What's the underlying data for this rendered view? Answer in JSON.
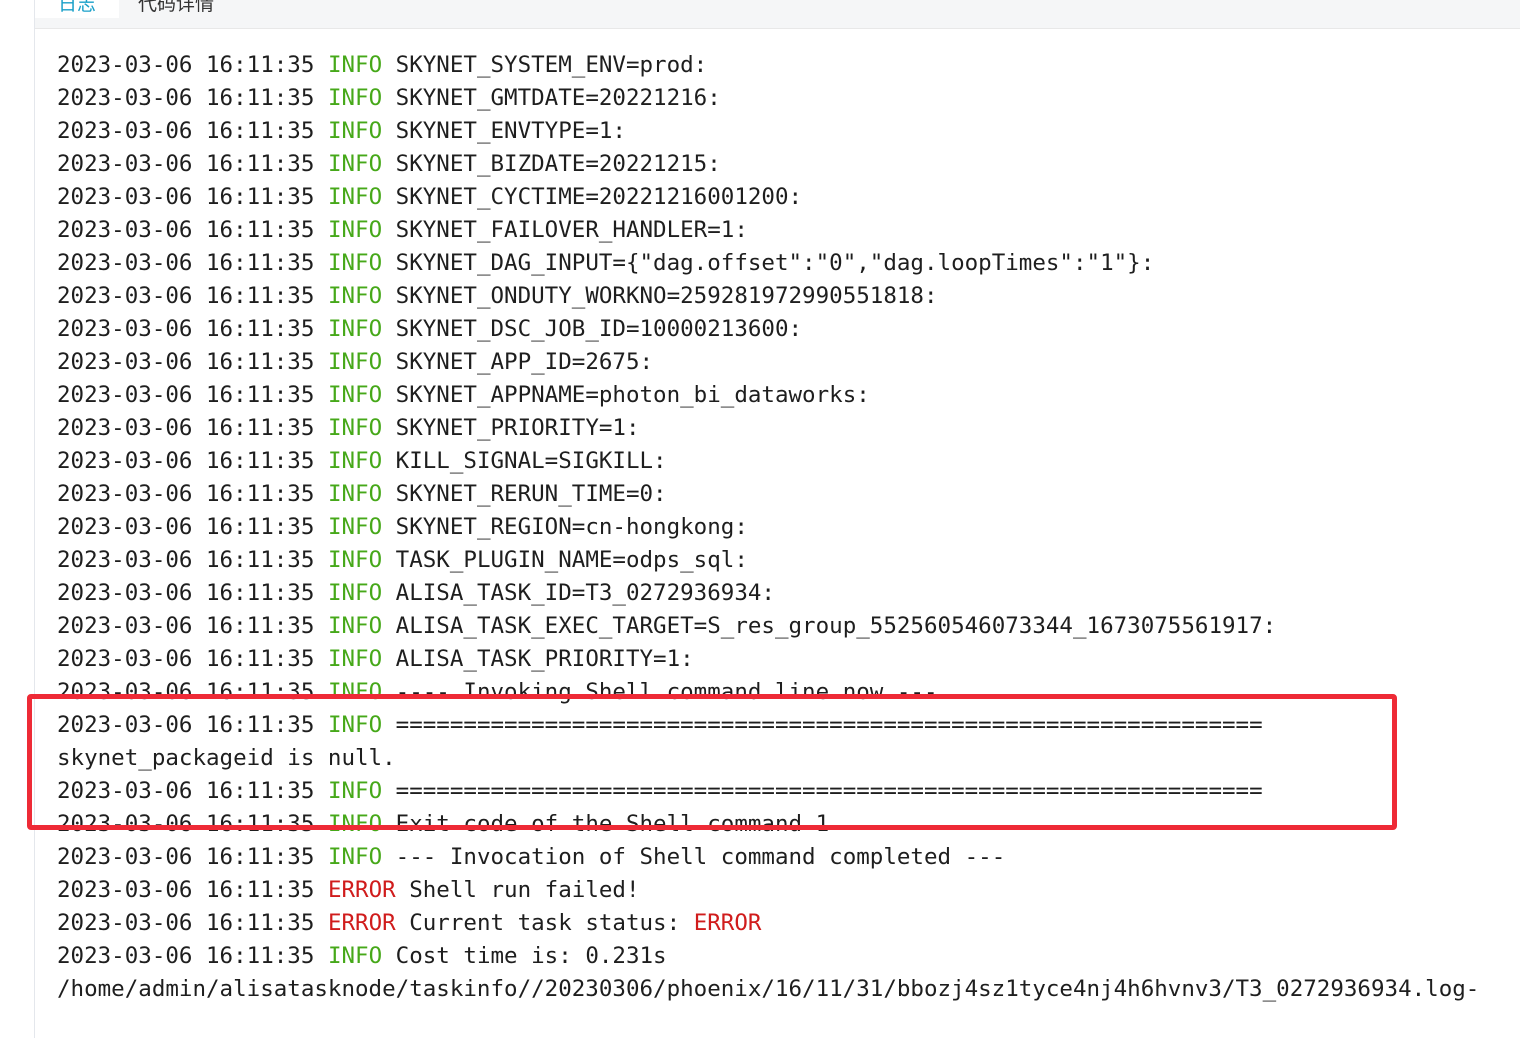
{
  "tabs": {
    "log_label": "日志",
    "code_label": "代码详情"
  },
  "colors": {
    "info": "#46a819",
    "error": "#d01c1c",
    "active_tab": "#1aa0c9",
    "highlight": "#ee2a36"
  },
  "log": {
    "lines": [
      {
        "ts": "2023-03-06 16:11:35",
        "level": "INFO",
        "msg": "SKYNET_SYSTEM_ENV=prod:"
      },
      {
        "ts": "2023-03-06 16:11:35",
        "level": "INFO",
        "msg": "SKYNET_GMTDATE=20221216:"
      },
      {
        "ts": "2023-03-06 16:11:35",
        "level": "INFO",
        "msg": "SKYNET_ENVTYPE=1:"
      },
      {
        "ts": "2023-03-06 16:11:35",
        "level": "INFO",
        "msg": "SKYNET_BIZDATE=20221215:"
      },
      {
        "ts": "2023-03-06 16:11:35",
        "level": "INFO",
        "msg": "SKYNET_CYCTIME=20221216001200:"
      },
      {
        "ts": "2023-03-06 16:11:35",
        "level": "INFO",
        "msg": "SKYNET_FAILOVER_HANDLER=1:"
      },
      {
        "ts": "2023-03-06 16:11:35",
        "level": "INFO",
        "msg": "SKYNET_DAG_INPUT={\"dag.offset\":\"0\",\"dag.loopTimes\":\"1\"}:"
      },
      {
        "ts": "2023-03-06 16:11:35",
        "level": "INFO",
        "msg": "SKYNET_ONDUTY_WORKNO=259281972990551818:"
      },
      {
        "ts": "2023-03-06 16:11:35",
        "level": "INFO",
        "msg": "SKYNET_DSC_JOB_ID=10000213600:"
      },
      {
        "ts": "2023-03-06 16:11:35",
        "level": "INFO",
        "msg": "SKYNET_APP_ID=2675:"
      },
      {
        "ts": "2023-03-06 16:11:35",
        "level": "INFO",
        "msg": "SKYNET_APPNAME=photon_bi_dataworks:"
      },
      {
        "ts": "2023-03-06 16:11:35",
        "level": "INFO",
        "msg": "SKYNET_PRIORITY=1:"
      },
      {
        "ts": "2023-03-06 16:11:35",
        "level": "INFO",
        "msg": "KILL_SIGNAL=SIGKILL:"
      },
      {
        "ts": "2023-03-06 16:11:35",
        "level": "INFO",
        "msg": "SKYNET_RERUN_TIME=0:"
      },
      {
        "ts": "2023-03-06 16:11:35",
        "level": "INFO",
        "msg": "SKYNET_REGION=cn-hongkong:"
      },
      {
        "ts": "2023-03-06 16:11:35",
        "level": "INFO",
        "msg": "TASK_PLUGIN_NAME=odps_sql:"
      },
      {
        "ts": "2023-03-06 16:11:35",
        "level": "INFO",
        "msg": "ALISA_TASK_ID=T3_0272936934:"
      },
      {
        "ts": "2023-03-06 16:11:35",
        "level": "INFO",
        "msg": "ALISA_TASK_EXEC_TARGET=S_res_group_552560546073344_1673075561917:"
      },
      {
        "ts": "2023-03-06 16:11:35",
        "level": "INFO",
        "msg": "ALISA_TASK_PRIORITY=1:"
      },
      {
        "ts": "2023-03-06 16:11:35",
        "level": "INFO",
        "msg": "---- Invoking Shell command line now ---"
      },
      {
        "ts": "2023-03-06 16:11:35",
        "level": "INFO",
        "msg": "================================================================"
      },
      {
        "ts": "",
        "level": "",
        "msg": "skynet_packageid is null."
      },
      {
        "ts": "2023-03-06 16:11:35",
        "level": "INFO",
        "msg": "================================================================"
      },
      {
        "ts": "2023-03-06 16:11:35",
        "level": "INFO",
        "msg": "Exit code of the Shell command 1"
      },
      {
        "ts": "2023-03-06 16:11:35",
        "level": "INFO",
        "msg": "--- Invocation of Shell command completed ---"
      },
      {
        "ts": "2023-03-06 16:11:35",
        "level": "ERROR",
        "msg": "Shell run failed!"
      },
      {
        "ts": "2023-03-06 16:11:35",
        "level": "ERROR",
        "msg": "Current task status:",
        "status": "ERROR"
      },
      {
        "ts": "2023-03-06 16:11:35",
        "level": "INFO",
        "msg": "Cost time is: 0.231s"
      },
      {
        "ts": "",
        "level": "",
        "msg": "/home/admin/alisatasknode/taskinfo//20230306/phoenix/16/11/31/bbozj4sz1tyce4nj4h6hvnv3/T3_0272936934.log-"
      }
    ]
  }
}
